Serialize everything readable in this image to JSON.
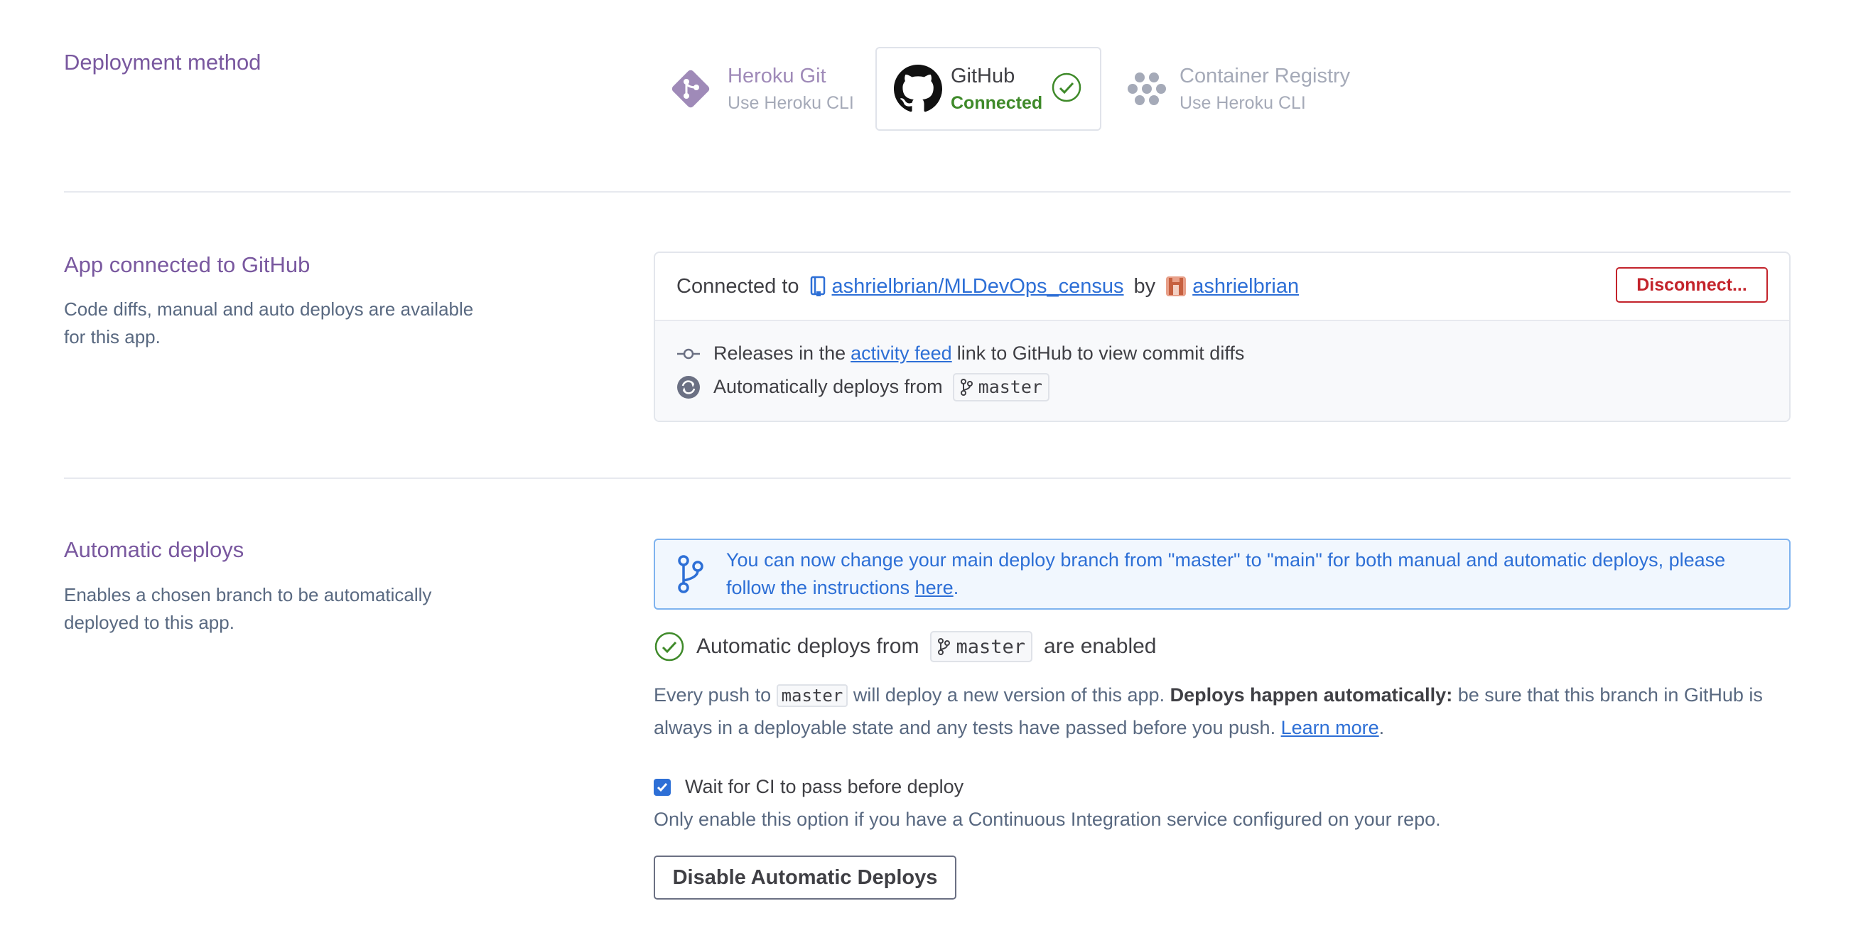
{
  "deployment": {
    "title": "Deployment method",
    "methods": [
      {
        "name": "Heroku Git",
        "sub": "Use Heroku CLI",
        "icon": "heroku-git-icon"
      },
      {
        "name": "GitHub",
        "sub": "Connected",
        "icon": "github-icon"
      },
      {
        "name": "Container Registry",
        "sub": "Use Heroku CLI",
        "icon": "container-registry-icon"
      }
    ]
  },
  "github": {
    "title": "App connected to GitHub",
    "desc": "Code diffs, manual and auto deploys are available for this app.",
    "connected_label": "Connected to",
    "repo": "ashrielbrian/MLDevOps_census",
    "by": "by",
    "user": "ashrielbrian",
    "disconnect": "Disconnect...",
    "releases_pre": "Releases in the",
    "releases_link": "activity feed",
    "releases_post": "link to GitHub to view commit diffs",
    "auto_label": "Automatically deploys from",
    "branch": "master"
  },
  "auto": {
    "title": "Automatic deploys",
    "desc": "Enables a chosen branch to be automatically deployed to this app.",
    "banner_text": "You can now change your main deploy branch from \"master\" to \"main\" for both manual and automatic deploys, please follow the instructions",
    "banner_link": "here",
    "enabled_pre": "Automatic deploys from",
    "branch": "master",
    "enabled_post": "are enabled",
    "para_1": "Every push to",
    "para_code": "master",
    "para_2": "will deploy a new version of this app.",
    "para_bold": "Deploys happen automatically:",
    "para_3": "be sure that this branch in GitHub is always in a deployable state and any tests have passed before you push.",
    "learn_more": "Learn more",
    "ci_label": "Wait for CI to pass before deploy",
    "ci_checked": true,
    "ci_hint": "Only enable this option if you have a Continuous Integration service configured on your repo.",
    "disable_button": "Disable Automatic Deploys"
  },
  "colors": {
    "heroku_purple": "#79589f",
    "link_blue": "#2d6fd6",
    "success_green": "#3f8a2a",
    "danger_red": "#c3232b"
  }
}
